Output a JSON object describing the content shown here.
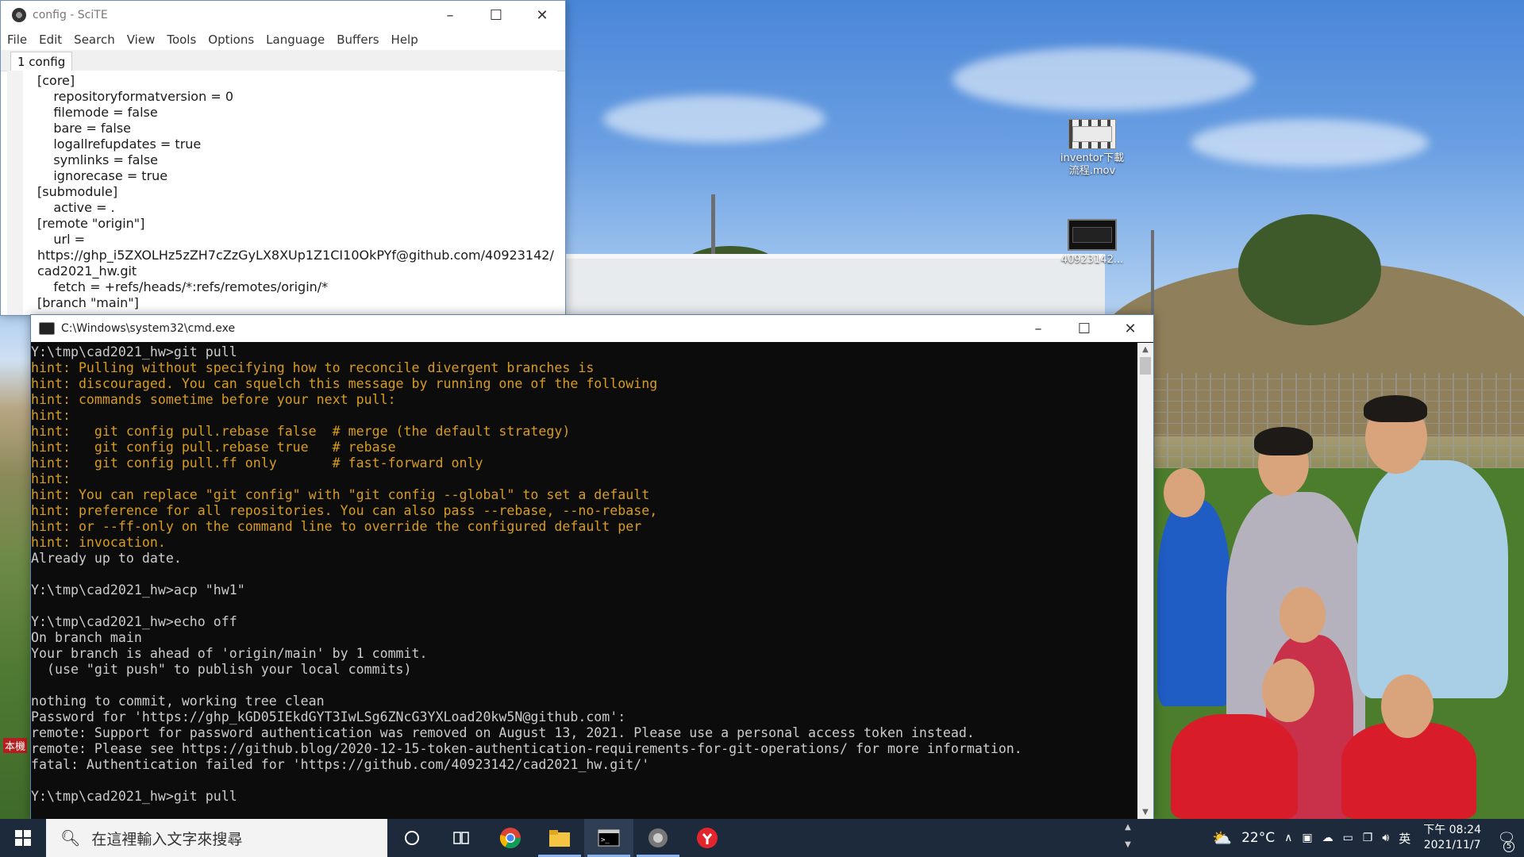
{
  "scite": {
    "title": "config - SciTE",
    "menu": [
      "File",
      "Edit",
      "Search",
      "View",
      "Tools",
      "Options",
      "Language",
      "Buffers",
      "Help"
    ],
    "tab": "1 config",
    "lines": [
      "[core]",
      "    repositoryformatversion = 0",
      "    filemode = false",
      "    bare = false",
      "    logallrefupdates = true",
      "    symlinks = false",
      "    ignorecase = true",
      "[submodule]",
      "    active = .",
      "[remote \"origin\"]",
      "    url =",
      "https://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@github.com/40923142/",
      "cad2021_hw.git",
      "    fetch = +refs/heads/*:refs/remotes/origin/*",
      "[branch \"main\"]"
    ]
  },
  "cmd": {
    "title": "C:\\Windows\\system32\\cmd.exe",
    "lines": [
      {
        "t": "Y:\\tmp\\cad2021_hw>git pull",
        "c": "n"
      },
      {
        "t": "hint: Pulling without specifying how to reconcile divergent branches is",
        "c": "h"
      },
      {
        "t": "hint: discouraged. You can squelch this message by running one of the following",
        "c": "h"
      },
      {
        "t": "hint: commands sometime before your next pull:",
        "c": "h"
      },
      {
        "t": "hint:",
        "c": "h"
      },
      {
        "t": "hint:   git config pull.rebase false  # merge (the default strategy)",
        "c": "h"
      },
      {
        "t": "hint:   git config pull.rebase true   # rebase",
        "c": "h"
      },
      {
        "t": "hint:   git config pull.ff only       # fast-forward only",
        "c": "h"
      },
      {
        "t": "hint:",
        "c": "h"
      },
      {
        "t": "hint: You can replace \"git config\" with \"git config --global\" to set a default",
        "c": "h"
      },
      {
        "t": "hint: preference for all repositories. You can also pass --rebase, --no-rebase,",
        "c": "h"
      },
      {
        "t": "hint: or --ff-only on the command line to override the configured default per",
        "c": "h"
      },
      {
        "t": "hint: invocation.",
        "c": "h"
      },
      {
        "t": "Already up to date.",
        "c": "n"
      },
      {
        "t": "",
        "c": "n"
      },
      {
        "t": "Y:\\tmp\\cad2021_hw>acp \"hw1\"",
        "c": "n"
      },
      {
        "t": "",
        "c": "n"
      },
      {
        "t": "Y:\\tmp\\cad2021_hw>echo off",
        "c": "n"
      },
      {
        "t": "On branch main",
        "c": "n"
      },
      {
        "t": "Your branch is ahead of 'origin/main' by 1 commit.",
        "c": "n"
      },
      {
        "t": "  (use \"git push\" to publish your local commits)",
        "c": "n"
      },
      {
        "t": "",
        "c": "n"
      },
      {
        "t": "nothing to commit, working tree clean",
        "c": "n"
      },
      {
        "t": "Password for 'https://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@github.com':",
        "c": "n"
      },
      {
        "t": "remote: Support for password authentication was removed on August 13, 2021. Please use a personal access token instead.",
        "c": "n"
      },
      {
        "t": "remote: Please see https://github.blog/2020-12-15-token-authentication-requirements-for-git-operations/ for more information.",
        "c": "n"
      },
      {
        "t": "fatal: Authentication failed for 'https://github.com/40923142/cad2021_hw.git/'",
        "c": "n"
      },
      {
        "t": "",
        "c": "n"
      },
      {
        "t": "Y:\\tmp\\cad2021_hw>git pull",
        "c": "n"
      }
    ]
  },
  "desktop_icons": [
    {
      "label_line1": "inventor下載",
      "label_line2": "流程.mov",
      "icon": "video-file-icon"
    },
    {
      "label_line1": "40923142...",
      "label_line2": "",
      "icon": "video-thumbnail-icon"
    }
  ],
  "desktop_side_label": "本機",
  "taskbar": {
    "search_placeholder": "在這裡輸入文字來搜尋",
    "weather_temp": "22°C",
    "ime": "英",
    "time": "下午 08:24",
    "date": "2021/11/7",
    "notification_count": "5"
  }
}
